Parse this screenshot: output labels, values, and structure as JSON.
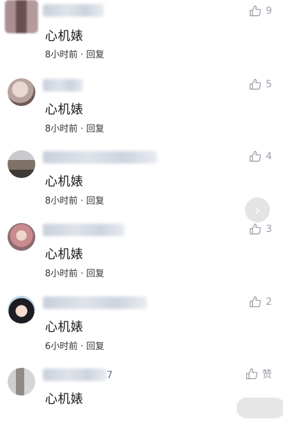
{
  "comments": [
    {
      "avatar": "pixelated-avatar",
      "name_tail": "",
      "content": "心机婊",
      "meta": "8小时前 · 回复",
      "likes": "9"
    },
    {
      "avatar": "sleeping-face-avatar",
      "name_tail": "",
      "content": "心机婊",
      "meta": "8小时前 · 回复",
      "likes": "5"
    },
    {
      "avatar": "street-scene-avatar",
      "name_tail": "",
      "content": "心机婊",
      "meta": "8小时前 · 回复",
      "likes": "4"
    },
    {
      "avatar": "girl-pink-avatar",
      "name_tail": "",
      "content": "心机婊",
      "meta": "8小时前 · 回复",
      "likes": "3"
    },
    {
      "avatar": "anime-girl-avatar",
      "name_tail": "",
      "content": "心机婊",
      "meta": "6小时前 · 回复",
      "likes": "2"
    },
    {
      "avatar": "doorway-avatar",
      "name_tail": "7",
      "content": "心机婊",
      "meta": "",
      "likes": "赞"
    }
  ],
  "colors": {
    "link": "#5a6f94",
    "icon": "#9aa0a8"
  }
}
